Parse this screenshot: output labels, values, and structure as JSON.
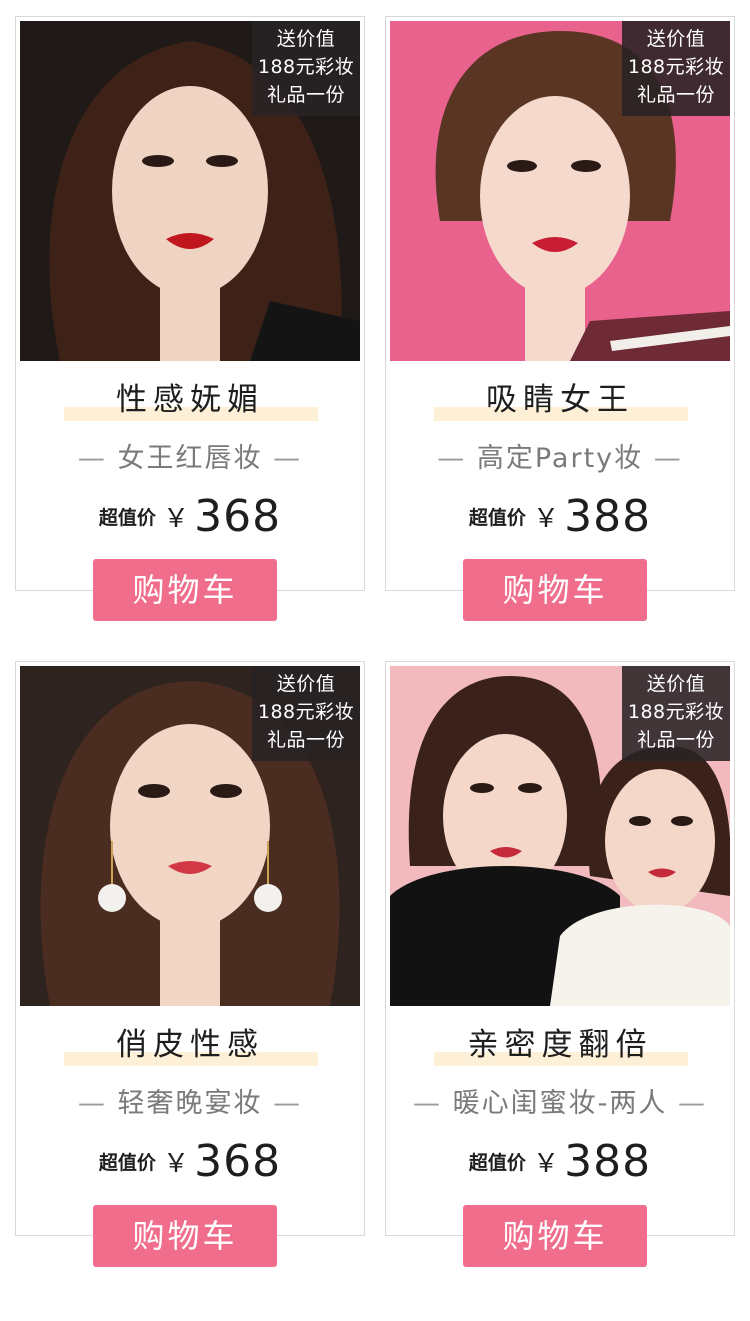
{
  "products": [
    {
      "gift_lines": [
        "送价值",
        "188元彩妆",
        "礼品一份"
      ],
      "title": "性感妩媚",
      "subtitle": "女王红唇妆",
      "price_label": "超值价",
      "currency": "￥",
      "price": "368",
      "cart_label": "购物车",
      "photo_bg": "#1f1a17",
      "photo_hair": "#3e2218",
      "photo_skin": "#efd3c3",
      "photo_lips": "#c0171f"
    },
    {
      "gift_lines": [
        "送价值",
        "188元彩妆",
        "礼品一份"
      ],
      "title": "吸睛女王",
      "subtitle": "高定Party妆",
      "price_label": "超值价",
      "currency": "￥",
      "price": "388",
      "cart_label": "购物车",
      "photo_bg": "#e8628d",
      "photo_hair": "#5a3524",
      "photo_skin": "#f5d9cc",
      "photo_lips": "#c81d33"
    },
    {
      "gift_lines": [
        "送价值",
        "188元彩妆",
        "礼品一份"
      ],
      "title": "俏皮性感",
      "subtitle": "轻奢晚宴妆",
      "price_label": "超值价",
      "currency": "￥",
      "price": "368",
      "cart_label": "购物车",
      "photo_bg": "#2e231f",
      "photo_hair": "#4b2c20",
      "photo_skin": "#f1d6c6",
      "photo_lips": "#d23746"
    },
    {
      "gift_lines": [
        "送价值",
        "188元彩妆",
        "礼品一份"
      ],
      "title": "亲密度翻倍",
      "subtitle": "暖心闺蜜妆-两人",
      "price_label": "超值价",
      "currency": "￥",
      "price": "388",
      "cart_label": "购物车",
      "photo_bg": "#f2b9bf",
      "photo_hair": "#3a221a",
      "photo_skin": "#f4d7c9",
      "photo_lips": "#c52a3a"
    }
  ],
  "colors": {
    "accent": "#f06e8c",
    "title_highlight": "#fdf0d7",
    "gift_bg": "#2a2426"
  }
}
